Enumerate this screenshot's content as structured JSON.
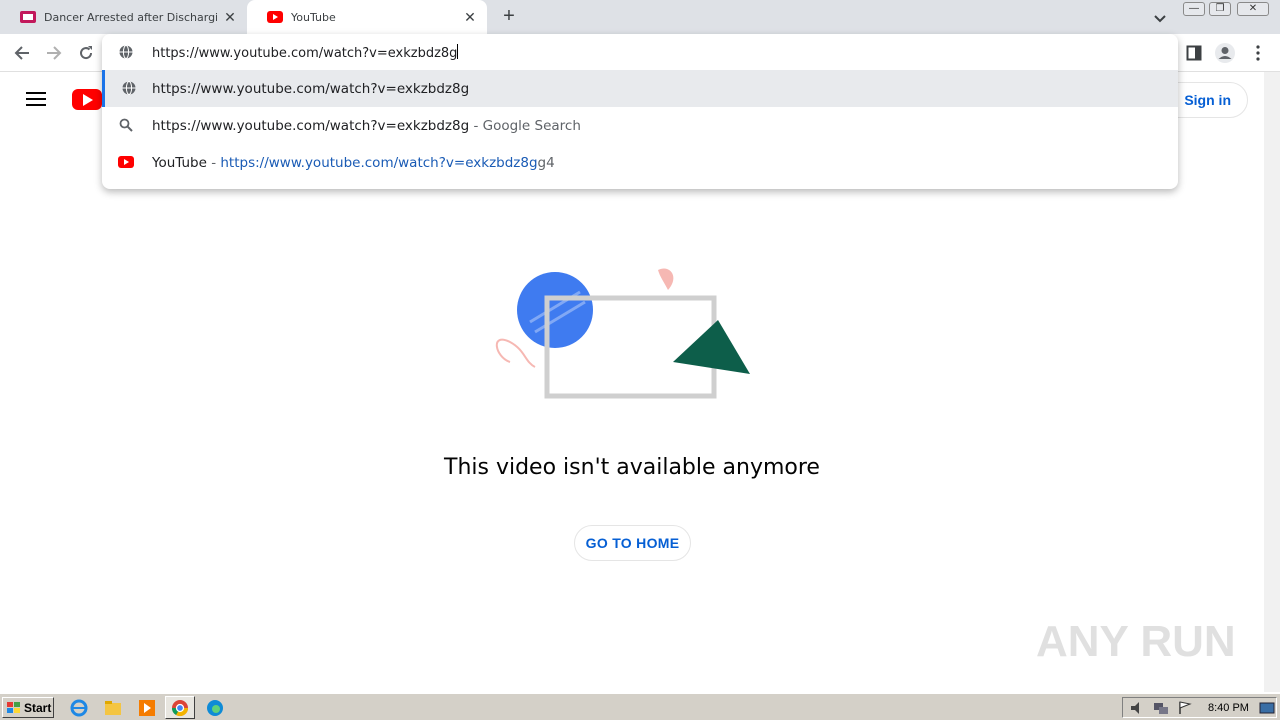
{
  "browser": {
    "tabs": [
      {
        "title": "Dancer Arrested after Discharging G",
        "active": false
      },
      {
        "title": "YouTube",
        "active": true
      }
    ],
    "address": "https://www.youtube.com/watch?v=exkzbdz8g"
  },
  "omnibox": {
    "input_text": "https://www.youtube.com/watch?v=exkzbdz8g",
    "suggestions": [
      {
        "main": "https://www.youtube.com/watch?v=exkzbdz8g",
        "suffix": "",
        "icon": "globe-icon"
      },
      {
        "main": "https://www.youtube.com/watch?v=exkzbdz8g",
        "suffix": " - Google Search",
        "icon": "search-icon"
      },
      {
        "main": "YouTube",
        "separator": " - ",
        "url": "https://www.youtube.com/watch?v=exkzbdz8g",
        "url_tail": "g4",
        "icon": "youtube-icon"
      }
    ]
  },
  "youtube": {
    "signin_label": "Sign in",
    "message": "This video isn't available anymore",
    "home_button": "GO TO HOME",
    "brand_color": "#ff0000",
    "link_color": "#065fd4"
  },
  "watermark": {
    "text": "ANY RUN"
  },
  "taskbar": {
    "start_label": "Start",
    "clock": "8:40 PM"
  }
}
